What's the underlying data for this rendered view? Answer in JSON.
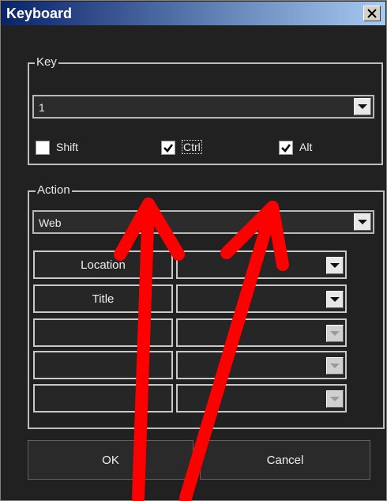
{
  "window": {
    "title": "Keyboard",
    "close_icon": "close-icon"
  },
  "key_group": {
    "label": "Key",
    "selected_key": "1",
    "modifiers": [
      {
        "label": "Shift",
        "checked": false
      },
      {
        "label": "Ctrl",
        "checked": true
      },
      {
        "label": "Alt",
        "checked": true
      }
    ]
  },
  "action_group": {
    "label": "Action",
    "selected_action": "Web",
    "params": [
      {
        "name": "Location",
        "value": "",
        "enabled": true
      },
      {
        "name": "Title",
        "value": "",
        "enabled": true
      },
      {
        "name": "",
        "value": "",
        "enabled": false
      },
      {
        "name": "",
        "value": "",
        "enabled": false
      },
      {
        "name": "",
        "value": "",
        "enabled": false
      }
    ]
  },
  "buttons": {
    "ok": "OK",
    "cancel": "Cancel"
  },
  "annotation": {
    "color": "#ff0000",
    "description_icons": [
      "red-arrow-icon",
      "red-arrow-icon"
    ]
  }
}
